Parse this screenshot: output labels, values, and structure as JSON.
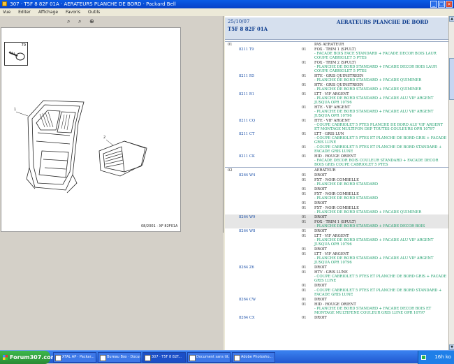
{
  "window": {
    "title": "307 · T5F 8 82F 01A · AERATEURS PLANCHE DE BORD · Packard Bell",
    "menu": [
      "Vue",
      "Editer",
      "Affichage",
      "Favoris",
      "Outils"
    ]
  },
  "drawing": {
    "inset_label": "70",
    "part_labels": [
      "1",
      "2"
    ],
    "reference": "08/2001 · XF 82F01A"
  },
  "detail": {
    "date": "25/10/07",
    "code": "T5F 8 82F 01A",
    "title": "AERATEURS PLANCHE DE BORD"
  },
  "groups": [
    {
      "number": "01",
      "rows": [
        {
          "ref": "",
          "qty": "",
          "label": "PAS AERATEUR",
          "desc": ""
        },
        {
          "ref": "8211 T9",
          "qty": "01",
          "label": "FOX · TRIM 1 (SPULT)",
          "desc": "- FACADE BOIS FACE STANDARD + FACADE DECOR BOIS LAUR COUPE CABRIOLET 5 PTES"
        },
        {
          "ref": "",
          "qty": "01",
          "label": "FOX · TRIM 2 (SPULT)",
          "desc": "- PLANCHE DE BORD STANDARD + FACADE DECOR BOIS LAUR COUPE CABRIOLET 5 PTES"
        },
        {
          "ref": "8211 R5",
          "qty": "01",
          "label": "HTE · GRIS QUINSTREEN",
          "desc": "- PLANCHE DE BORD STANDARD + FACADE QUIMINER"
        },
        {
          "ref": "",
          "qty": "01",
          "label": "HTE · GRIS QUINSTREEN",
          "desc": "- PLANCHE DE BORD STANDARD + FACADE QUIMINER"
        },
        {
          "ref": "8211 R1",
          "qty": "01",
          "label": "LTT · VIF ARGENT",
          "desc": "- PLANCHE DE BORD STANDARD + FACADE ALU VIF ARGENT JUSQUA OPR 10796"
        },
        {
          "ref": "",
          "qty": "01",
          "label": "HTE · VIF ARGENT",
          "desc": "- PLANCHE DE BORD STANDARD + FACADE ALU VIF ARGENT JUSQUA OPR 10796"
        },
        {
          "ref": "8211 CQ",
          "qty": "01",
          "label": "HTE · VIF ARGENT",
          "desc": "- COUPE CABRIOLET 5 PTES PLANCHE DE BORD ALU VIF ARGENT ET MONTAGE MULTIFON DEP TOUTES COULEURS OPR 10797"
        },
        {
          "ref": "8211 CT",
          "qty": "01",
          "label": "LTT · GRIS LUN",
          "desc": "- COUPE CABRIOLET 5 PTES ET PLANCHE DE BORD GRIS + FACADE GRIS LUNE"
        },
        {
          "ref": "",
          "qty": "01",
          "label": "",
          "desc": "- COUPE CABRIOLET 5 PTES ET PLANCHE DE BORD STANDARD + FACADE GRIS LUNE"
        },
        {
          "ref": "8211 CK",
          "qty": "01",
          "label": "HID · ROUGE ORIENT",
          "desc": "- FACADE DECOR BOIS COULEUR STANDARD + FACADE DECOR BOIS GRIS COUPE CABRIOLET 5 PTES"
        }
      ]
    },
    {
      "number": "02",
      "rows": [
        {
          "ref": "",
          "qty": "",
          "label": "AERATEUR",
          "desc": ""
        },
        {
          "ref": "8264 W4",
          "qty": "01",
          "label": "DROIT",
          "desc": ""
        },
        {
          "ref": "",
          "qty": "01",
          "label": "FXT · NOIR COMBELLE",
          "desc": "- PLANCHE DE BORD STANDARD"
        },
        {
          "ref": "",
          "qty": "01",
          "label": "DROIT",
          "desc": ""
        },
        {
          "ref": "",
          "qty": "01",
          "label": "FXT · NOIR COMBELLE",
          "desc": "- PLANCHE DE BORD STANDARD"
        },
        {
          "ref": "",
          "qty": "01",
          "label": "DROIT",
          "desc": ""
        },
        {
          "ref": "",
          "qty": "01",
          "label": "FXT · NOIR COMBELLE",
          "desc": "- PLANCHE DE BORD STANDARD + FACADE QUIMINER"
        },
        {
          "ref": "8264 W9",
          "qty": "01",
          "label": "DROIT",
          "desc": "",
          "shaded": true
        },
        {
          "ref": "",
          "qty": "01",
          "label": "FOX · TRIM 1 (SPULT)",
          "desc": "- PLANCHE DE BORD STANDARD + FACADE DECOR BOIS",
          "shaded": true
        },
        {
          "ref": "8264 W8",
          "qty": "01",
          "label": "DROIT",
          "desc": ""
        },
        {
          "ref": "",
          "qty": "01",
          "label": "LTT · VIF ARGENT",
          "desc": "- PLANCHE DE BORD STANDARD + FACADE ALU VIF ARGENT JUSQUA OPR 10796"
        },
        {
          "ref": "",
          "qty": "01",
          "label": "DROIT",
          "desc": ""
        },
        {
          "ref": "",
          "qty": "01",
          "label": "LTT · VIF ARGENT",
          "desc": "- PLANCHE DE BORD STANDARD + FACADE ALU VIF ARGENT JUSQUA OPR 10796"
        },
        {
          "ref": "8264 Z6",
          "qty": "01",
          "label": "DROIT",
          "desc": ""
        },
        {
          "ref": "",
          "qty": "01",
          "label": "HTV · GRIS LUNE",
          "desc": "- COUPE CABRIOLET 5 PTES ET PLANCHE DE BORD GRIS + FACADE GRIS LUNE"
        },
        {
          "ref": "",
          "qty": "01",
          "label": "DROIT",
          "desc": ""
        },
        {
          "ref": "",
          "qty": "01",
          "label": "",
          "desc": "- COUPE CABRIOLET 5 PTES ET PLANCHE DE BORD STANDARD + FACADE GRIS LUNE"
        },
        {
          "ref": "8264 CW",
          "qty": "01",
          "label": "DROIT",
          "desc": ""
        },
        {
          "ref": "",
          "qty": "01",
          "label": "HID · ROUGE ORIENT",
          "desc": "- PLANCHE DE BORD STANDARD + FACADE DECOR BOIS ET MONTAGE MULTIFENE COULEUR GRIS LUNE OPR 10797"
        },
        {
          "ref": "8264 CX",
          "qty": "01",
          "label": "DROIT",
          "desc": ""
        }
      ]
    }
  ],
  "taskbar": {
    "start_label": "Forum307.com",
    "tasks": [
      "XTAL AP · Packar...",
      "Bureau Box · Docume...",
      "307 · T5F 8 82F...",
      "Document sans tit...",
      "Adobe Photosho..."
    ],
    "tray_text": "16h ko"
  }
}
